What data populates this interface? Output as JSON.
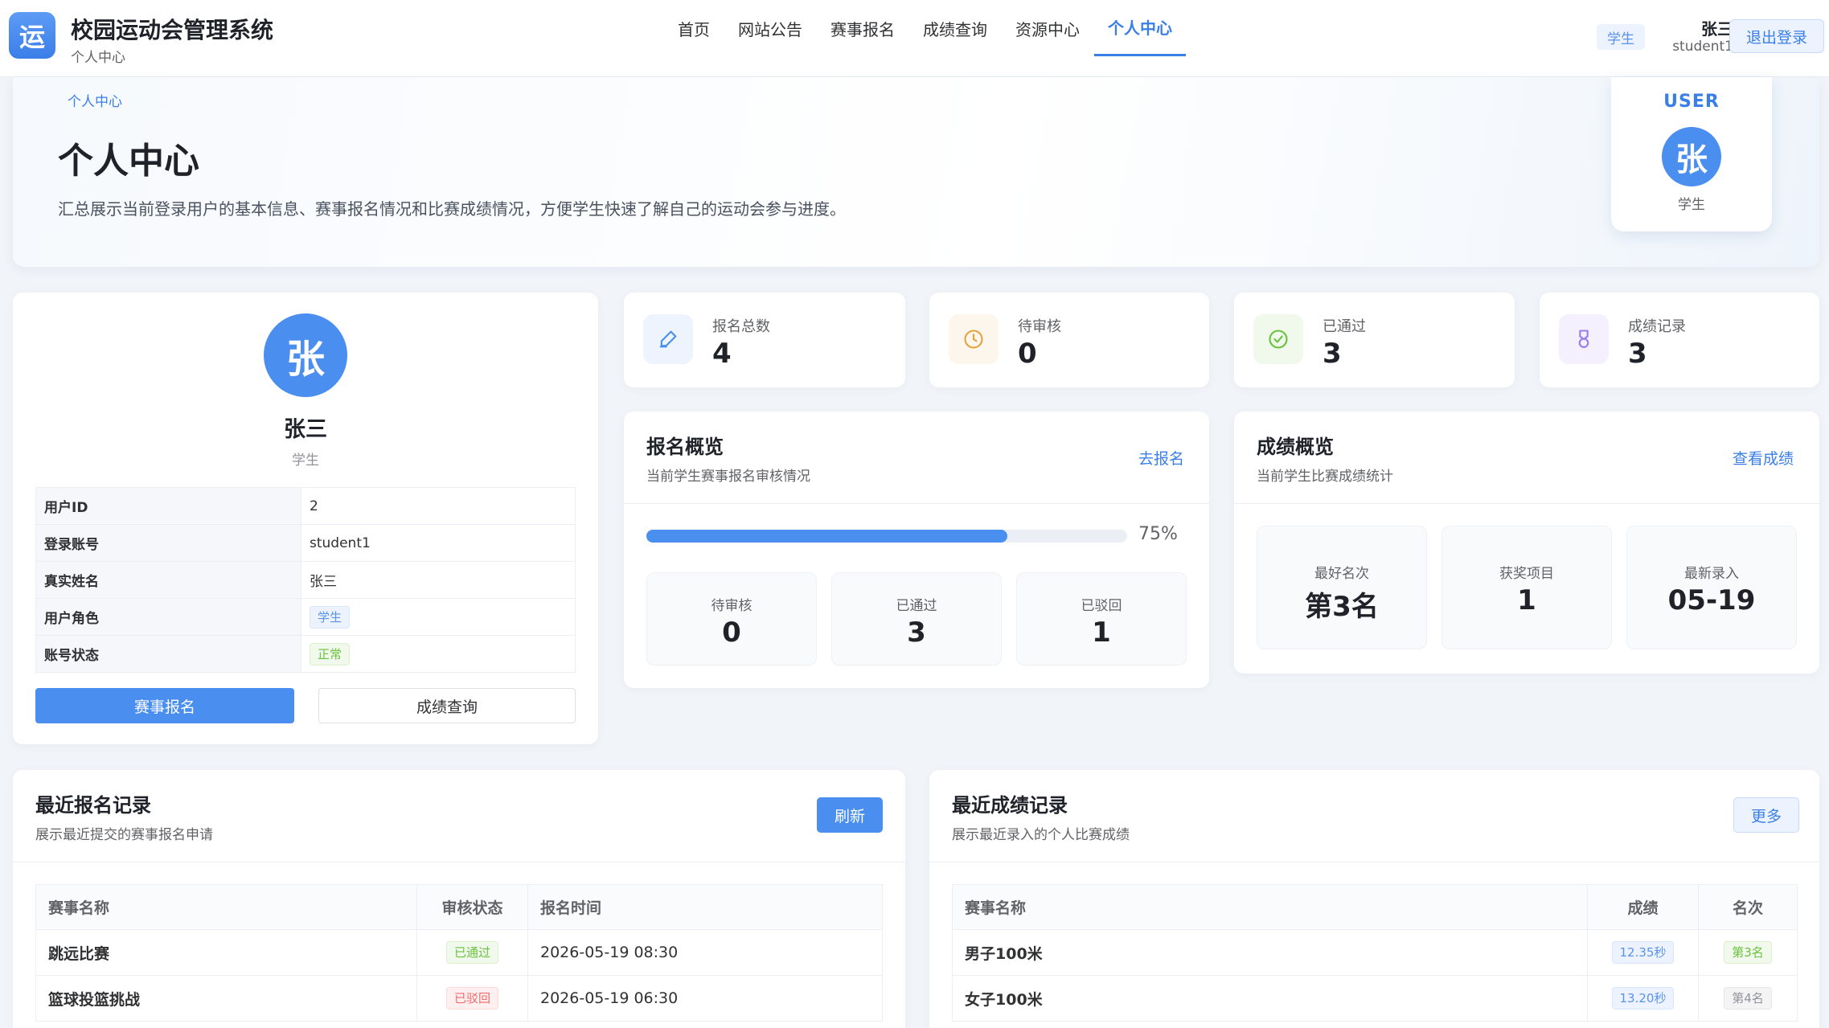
{
  "header": {
    "logo_char": "运",
    "app_title": "校园运动会管理系统",
    "app_subtitle": "个人中心",
    "nav": [
      "首页",
      "网站公告",
      "赛事报名",
      "成绩查询",
      "资源中心",
      "个人中心"
    ],
    "active_nav": "个人中心",
    "role_tag": "学生",
    "user_name": "张三",
    "user_account": "student1",
    "logout_label": "退出登录"
  },
  "hero": {
    "breadcrumb": "个人中心",
    "title": "个人中心",
    "description": "汇总展示当前登录用户的基本信息、赛事报名情况和比赛成绩情况，方便学生快速了解自己的运动会参与进度。",
    "user_card": {
      "label": "USER",
      "avatar_char": "张",
      "role": "学生"
    }
  },
  "profile": {
    "avatar_char": "张",
    "name": "张三",
    "role": "学生",
    "fields": [
      {
        "key": "用户ID",
        "value": "2"
      },
      {
        "key": "登录账号",
        "value": "student1"
      },
      {
        "key": "真实姓名",
        "value": "张三"
      },
      {
        "key": "用户角色",
        "value": "学生"
      },
      {
        "key": "账号状态",
        "value": "正常"
      }
    ],
    "primary_button": "赛事报名",
    "secondary_button": "成绩查询"
  },
  "stats": [
    {
      "label": "报名总数",
      "value": "4",
      "icon": "pencil-icon",
      "color": "#4a8ef0",
      "bg": "#eef4fd"
    },
    {
      "label": "待审核",
      "value": "0",
      "icon": "clock-icon",
      "color": "#e6a23c",
      "bg": "#fdf6ec"
    },
    {
      "label": "已通过",
      "value": "3",
      "icon": "check-circle-icon",
      "color": "#67c23a",
      "bg": "#f0f9eb"
    },
    {
      "label": "成绩记录",
      "value": "3",
      "icon": "medal-icon",
      "color": "#9a7cf0",
      "bg": "#f4f0fd"
    }
  ],
  "signup_overview": {
    "title": "报名概览",
    "subtitle": "当前学生赛事报名审核情况",
    "link": "去报名",
    "progress": 75,
    "progress_text": "75%",
    "items": [
      {
        "label": "待审核",
        "value": "0"
      },
      {
        "label": "已通过",
        "value": "3"
      },
      {
        "label": "已驳回",
        "value": "1"
      }
    ]
  },
  "score_overview": {
    "title": "成绩概览",
    "subtitle": "当前学生比赛成绩统计",
    "link": "查看成绩",
    "items": [
      {
        "label": "最好名次",
        "value": "第3名"
      },
      {
        "label": "获奖项目",
        "value": "1"
      },
      {
        "label": "最新录入",
        "value": "05-19"
      }
    ]
  },
  "recent_signups": {
    "title": "最近报名记录",
    "subtitle": "展示最近提交的赛事报名申请",
    "button": "刷新",
    "columns": [
      "赛事名称",
      "审核状态",
      "报名时间"
    ],
    "rows": [
      {
        "name": "跳远比赛",
        "status": "已通过",
        "time": "2026-05-19 08:30"
      },
      {
        "name": "篮球投篮挑战",
        "status": "已驳回",
        "time": "2026-05-19 06:30"
      }
    ]
  },
  "recent_scores": {
    "title": "最近成绩记录",
    "subtitle": "展示最近录入的个人比赛成绩",
    "button": "更多",
    "columns": [
      "赛事名称",
      "成绩",
      "名次"
    ],
    "rows": [
      {
        "name": "男子100米",
        "score": "12.35秒",
        "rank": "第3名"
      },
      {
        "name": "女子100米",
        "score": "13.20秒",
        "rank": "第4名"
      }
    ]
  }
}
